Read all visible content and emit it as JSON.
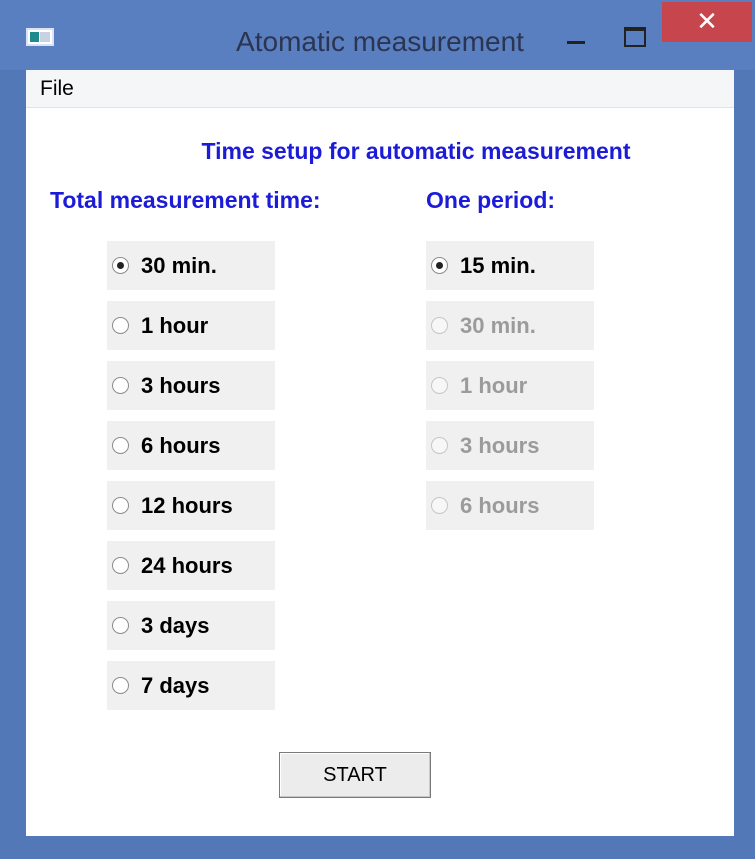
{
  "window": {
    "title": "Atomatic measurement",
    "close_glyph": "✕"
  },
  "menu": {
    "items": [
      {
        "label": "File"
      }
    ]
  },
  "content": {
    "heading": "Time setup for automatic measurement",
    "total_label": "Total measurement time:",
    "period_label": "One period:",
    "total_options": [
      {
        "label": "30 min.",
        "checked": true,
        "enabled": true
      },
      {
        "label": "1 hour",
        "checked": false,
        "enabled": true
      },
      {
        "label": "3 hours",
        "checked": false,
        "enabled": true
      },
      {
        "label": "6 hours",
        "checked": false,
        "enabled": true
      },
      {
        "label": "12 hours",
        "checked": false,
        "enabled": true
      },
      {
        "label": "24 hours",
        "checked": false,
        "enabled": true
      },
      {
        "label": "3 days",
        "checked": false,
        "enabled": true
      },
      {
        "label": "7 days",
        "checked": false,
        "enabled": true
      }
    ],
    "period_options": [
      {
        "label": "15 min.",
        "checked": true,
        "enabled": true
      },
      {
        "label": "30 min.",
        "checked": false,
        "enabled": false
      },
      {
        "label": "1 hour",
        "checked": false,
        "enabled": false
      },
      {
        "label": "3 hours",
        "checked": false,
        "enabled": false
      },
      {
        "label": "6 hours",
        "checked": false,
        "enabled": false
      }
    ],
    "start_label": "START"
  },
  "colors": {
    "titlebar": "#5a7fc0",
    "close_button": "#c7454c",
    "label_blue": "#1c1cd8",
    "disabled_text": "#9b9b9b"
  }
}
